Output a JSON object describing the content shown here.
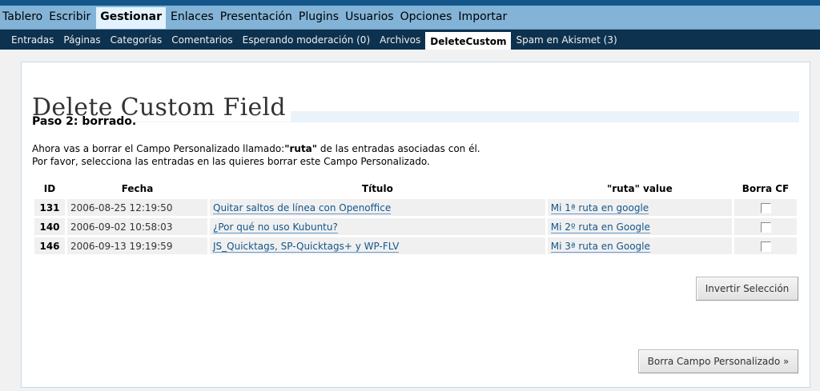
{
  "main_menu": [
    {
      "label": "Tablero",
      "active": false
    },
    {
      "label": "Escribir",
      "active": false
    },
    {
      "label": "Gestionar",
      "active": true
    },
    {
      "label": "Enlaces",
      "active": false
    },
    {
      "label": "Presentación",
      "active": false
    },
    {
      "label": "Plugins",
      "active": false
    },
    {
      "label": "Usuarios",
      "active": false
    },
    {
      "label": "Opciones",
      "active": false
    },
    {
      "label": "Importar",
      "active": false
    }
  ],
  "sub_menu": [
    {
      "label": "Entradas",
      "active": false
    },
    {
      "label": "Páginas",
      "active": false
    },
    {
      "label": "Categorías",
      "active": false
    },
    {
      "label": "Comentarios",
      "active": false
    },
    {
      "label": "Esperando moderación (0)",
      "active": false
    },
    {
      "label": "Archivos",
      "active": false
    },
    {
      "label": "DeleteCustom",
      "active": true
    },
    {
      "label": "Spam en Akismet (3)",
      "active": false
    }
  ],
  "page": {
    "title": "Delete Custom Field",
    "step": "Paso 2: borrado.",
    "intro_line1_before": "Ahora vas a borrar el Campo Personalizado llamado:",
    "intro_field_name": "\"ruta\"",
    "intro_line1_after": " de las entradas asociadas con él.",
    "intro_line2": "Por favor, selecciona las entradas en las quieres borrar este Campo Personalizado."
  },
  "table": {
    "headers": {
      "id": "ID",
      "fecha": "Fecha",
      "titulo": "Título",
      "value": "\"ruta\" value",
      "borra": "Borra CF"
    },
    "rows": [
      {
        "id": "131",
        "fecha": "2006-08-25 12:19:50",
        "titulo": "Quitar saltos de línea con Openoffice",
        "value": "Mi 1ª ruta en google",
        "checked": false
      },
      {
        "id": "140",
        "fecha": "2006-09-02 10:58:03",
        "titulo": "¿Por qué no uso Kubuntu?",
        "value": "Mi 2º ruta en Google",
        "checked": false
      },
      {
        "id": "146",
        "fecha": "2006-09-13 19:19:59",
        "titulo": "JS_Quicktags, SP-Quicktags+ y WP-FLV",
        "value": "Mi 3ª ruta en Google",
        "checked": false
      }
    ]
  },
  "buttons": {
    "invert": "Invertir Selección",
    "delete": "Borra Campo Personalizado »"
  }
}
